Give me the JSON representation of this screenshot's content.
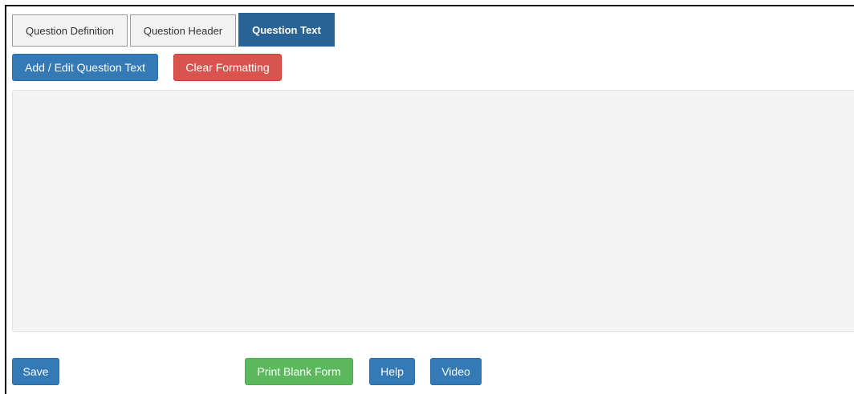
{
  "tabs": [
    {
      "label": "Question Definition",
      "active": false
    },
    {
      "label": "Question Header",
      "active": false
    },
    {
      "label": "Question Text",
      "active": true
    }
  ],
  "toolbar": {
    "add_edit_label": "Add / Edit Question Text",
    "clear_formatting_label": "Clear Formatting"
  },
  "editor": {
    "content": ""
  },
  "footer": {
    "save_label": "Save",
    "print_label": "Print Blank Form",
    "help_label": "Help",
    "video_label": "Video"
  },
  "colors": {
    "primary": "#337ab7",
    "active_tab": "#2a6496",
    "danger": "#d9534f",
    "success": "#5cb85c",
    "editor_bg": "#f4f4f4"
  }
}
